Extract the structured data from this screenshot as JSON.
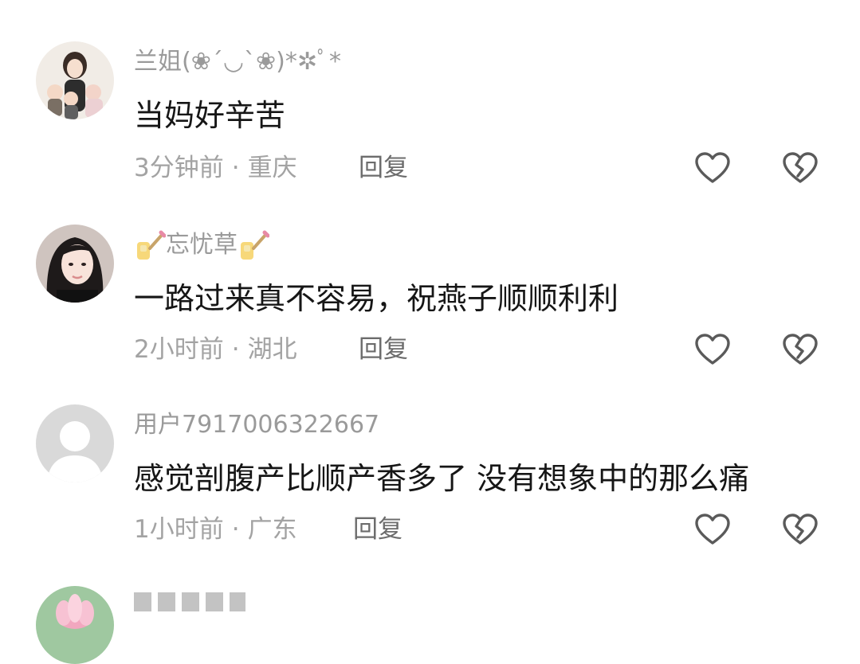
{
  "comments": [
    {
      "username": "兰姐(❀´◡`❀)*✲ﾟ*",
      "content": "当妈好辛苦",
      "time": "3分钟前",
      "separator": "·",
      "location": "重庆",
      "reply_label": "回复",
      "avatar": "avatar-mother-with-children"
    },
    {
      "username": "忘忧草",
      "content": "一路过来真不容易，祝燕子顺顺利利",
      "time": "2小时前",
      "separator": "·",
      "location": "湖北",
      "reply_label": "回复",
      "avatar": "avatar-woman-portrait",
      "username_decoration": "nail-polish-emoji"
    },
    {
      "username": "用户7917006322667",
      "content": "感觉剖腹产比顺产香多了 没有想象中的那么痛",
      "time": "1小时前",
      "separator": "·",
      "location": "广东",
      "reply_label": "回复",
      "avatar": "avatar-default-gray"
    }
  ],
  "icons": {
    "like": "heart-outline-icon",
    "dislike": "broken-heart-outline-icon"
  },
  "colors": {
    "username": "#9a9a9a",
    "content": "#161616",
    "meta": "#a3a3a3",
    "reply": "#6c6c6c",
    "icon": "#5a5a5a"
  }
}
